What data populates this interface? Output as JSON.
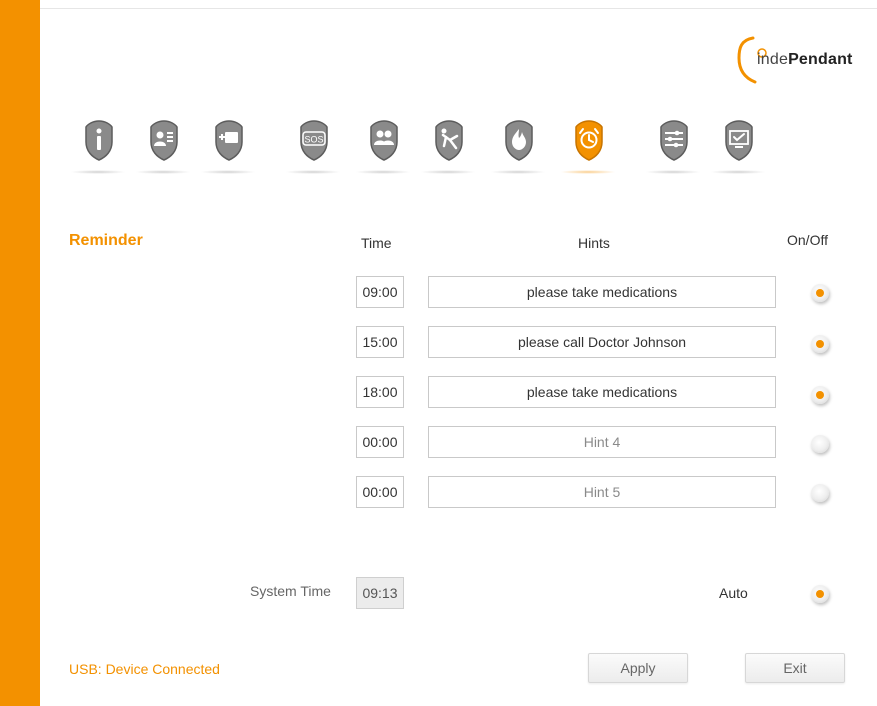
{
  "brand": {
    "logo_prefix": "inde",
    "logo_bold": "Pendant"
  },
  "nav": {
    "tabs": [
      {
        "icon": "info-icon",
        "active": false
      },
      {
        "icon": "user-card-icon",
        "active": false
      },
      {
        "icon": "battery-plug-icon",
        "active": false
      },
      {
        "icon": "sos-icon",
        "label": "SOS",
        "active": false
      },
      {
        "icon": "contacts-icon",
        "active": false
      },
      {
        "icon": "fall-detection-icon",
        "active": false
      },
      {
        "icon": "fire-icon",
        "active": false
      },
      {
        "icon": "alarm-clock-icon",
        "active": true
      },
      {
        "icon": "sliders-icon",
        "active": false
      },
      {
        "icon": "monitor-check-icon",
        "active": false
      }
    ]
  },
  "reminder": {
    "title": "Reminder",
    "col_time": "Time",
    "col_hints": "Hints",
    "col_onoff": "On/Off",
    "rows": [
      {
        "time": "09:00",
        "hint": "please take medications",
        "placeholder": false,
        "on": true
      },
      {
        "time": "15:00",
        "hint": "please call Doctor Johnson",
        "placeholder": false,
        "on": true
      },
      {
        "time": "18:00",
        "hint": "please take medications",
        "placeholder": false,
        "on": true
      },
      {
        "time": "00:00",
        "hint": "Hint 4",
        "placeholder": true,
        "on": false
      },
      {
        "time": "00:00",
        "hint": "Hint 5",
        "placeholder": true,
        "on": false
      }
    ]
  },
  "system_time": {
    "label": "System Time",
    "value": "09:13",
    "auto_label": "Auto",
    "auto_on": true
  },
  "footer": {
    "usb_status": "USB: Device Connected",
    "apply_label": "Apply",
    "exit_label": "Exit"
  },
  "colors": {
    "accent": "#f39100",
    "shield_inactive": "#8a8a8a"
  }
}
